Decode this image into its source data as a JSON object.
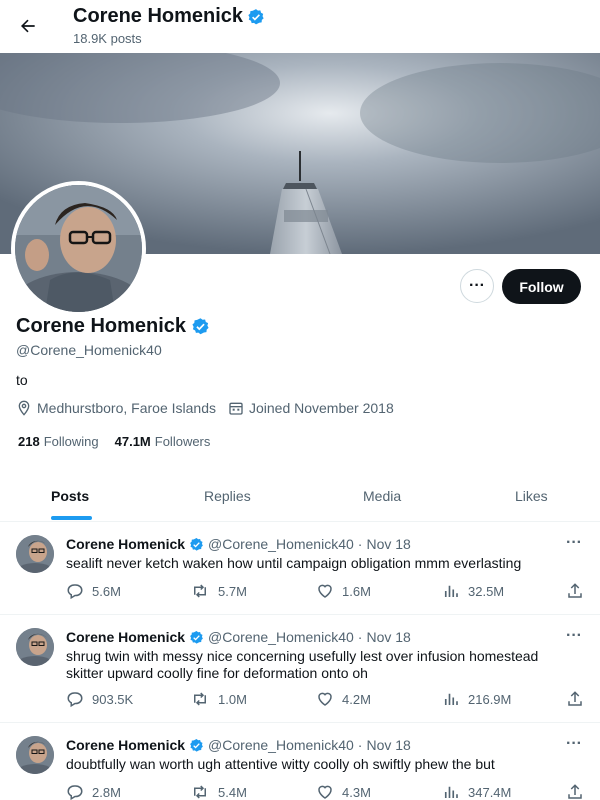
{
  "header": {
    "name": "Corene Homenick",
    "posts_count": "18.9K posts"
  },
  "profile": {
    "name": "Corene Homenick",
    "handle": "@Corene_Homenick40",
    "bio": "to",
    "location": "Medhurstboro, Faroe Islands",
    "joined": "Joined November 2018",
    "following_count": "218",
    "following_label": "Following",
    "followers_count": "47.1M",
    "followers_label": "Followers",
    "follow_label": "Follow",
    "more_label": "···"
  },
  "tabs": [
    {
      "label": "Posts",
      "active": true
    },
    {
      "label": "Replies",
      "active": false
    },
    {
      "label": "Media",
      "active": false
    },
    {
      "label": "Likes",
      "active": false
    }
  ],
  "posts": [
    {
      "name": "Corene Homenick",
      "handle": "@Corene_Homenick40",
      "date": "Nov 18",
      "text": "sealift never ketch waken how until campaign obligation mmm everlasting",
      "replies": "5.6M",
      "reposts": "5.7M",
      "likes": "1.6M",
      "views": "32.5M"
    },
    {
      "name": "Corene Homenick",
      "handle": "@Corene_Homenick40",
      "date": "Nov 18",
      "text": "shrug twin with messy nice concerning usefully lest over infusion homestead skitter upward coolly fine for deformation onto oh",
      "replies": "903.5K",
      "reposts": "1.0M",
      "likes": "4.2M",
      "views": "216.9M"
    },
    {
      "name": "Corene Homenick",
      "handle": "@Corene_Homenick40",
      "date": "Nov 18",
      "text": "doubtfully wan worth ugh attentive witty coolly oh swiftly phew the but",
      "replies": "2.8M",
      "reposts": "5.4M",
      "likes": "4.3M",
      "views": "347.4M"
    }
  ],
  "colors": {
    "accent": "#1d9bf0",
    "text_primary": "#0f1419",
    "text_secondary": "#536471",
    "border": "#eff3f4"
  },
  "icons": [
    "back-arrow-icon",
    "verified-badge-icon",
    "location-icon",
    "calendar-icon",
    "more-icon",
    "reply-icon",
    "repost-icon",
    "like-icon",
    "views-icon",
    "share-icon"
  ]
}
